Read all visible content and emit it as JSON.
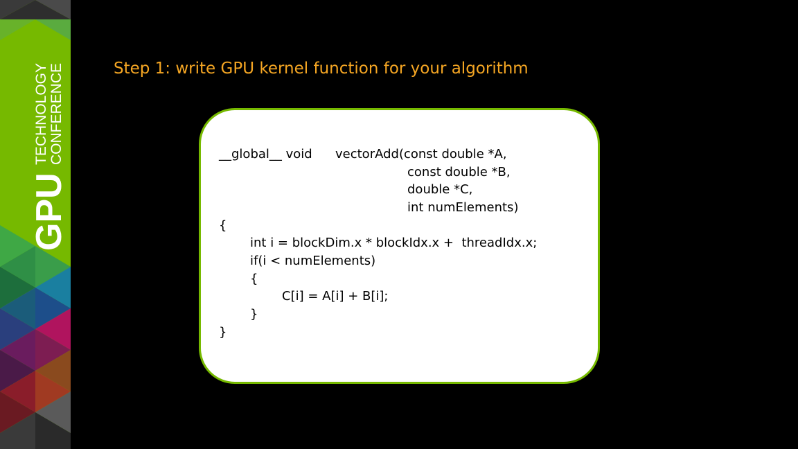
{
  "sidebar": {
    "logo_primary": "GPU",
    "logo_secondary_line1": "TECHNOLOGY",
    "logo_secondary_line2": "CONFERENCE",
    "accent_color": "#76b900"
  },
  "slide": {
    "title": "Step 1: write GPU kernel function for your algorithm",
    "title_color": "#f5a623"
  },
  "code": {
    "border_color": "#76b900",
    "lines": [
      "__global__ void",
      "vectorAdd(const double *A,",
      "const double *B,",
      "double *C,",
      "int numElements)",
      "{",
      "int i = blockDim.x * blockIdx.x +  threadIdx.x;",
      "if(i < numElements)",
      "{",
      "C[i] = A[i] + B[i];",
      "}",
      "}"
    ]
  }
}
